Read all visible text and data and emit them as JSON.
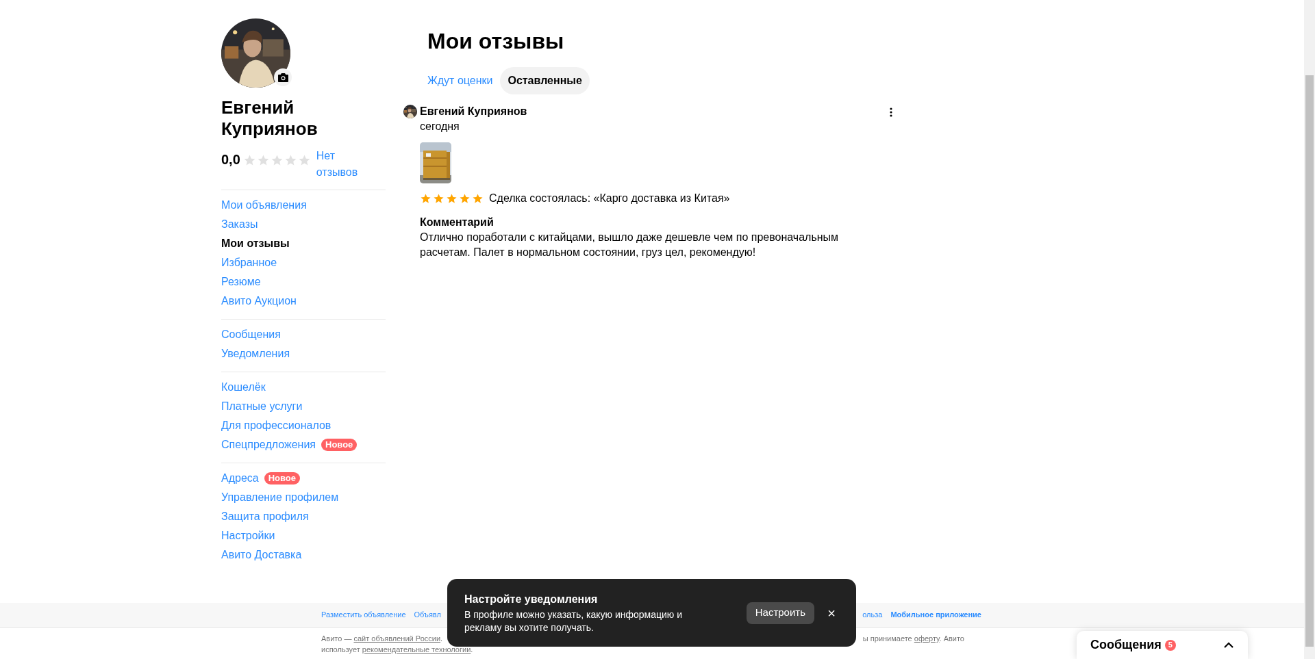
{
  "profile": {
    "name": "Евгений Куприянов",
    "rating": "0,0",
    "stars": 0,
    "reviews_link": "Нет отзывов"
  },
  "sidebar": {
    "groups": [
      {
        "items": [
          {
            "label": "Мои объявления",
            "selected": false
          },
          {
            "label": "Заказы",
            "selected": false
          },
          {
            "label": "Мои отзывы",
            "selected": true
          },
          {
            "label": "Избранное",
            "selected": false
          },
          {
            "label": "Резюме",
            "selected": false
          },
          {
            "label": "Авито Аукцион",
            "selected": false
          }
        ]
      },
      {
        "items": [
          {
            "label": "Сообщения",
            "selected": false
          },
          {
            "label": "Уведомления",
            "selected": false
          }
        ]
      },
      {
        "items": [
          {
            "label": "Кошелёк",
            "selected": false
          },
          {
            "label": "Платные услуги",
            "selected": false
          },
          {
            "label": "Для профессионалов",
            "selected": false
          },
          {
            "label": "Спецпредложения",
            "selected": false,
            "badge": "Новое"
          }
        ]
      },
      {
        "items": [
          {
            "label": "Адреса",
            "selected": false,
            "badge": "Новое"
          },
          {
            "label": "Управление профилем",
            "selected": false
          },
          {
            "label": "Защита профиля",
            "selected": false
          },
          {
            "label": "Настройки",
            "selected": false
          },
          {
            "label": "Авито Доставка",
            "selected": false
          }
        ]
      }
    ]
  },
  "page_title": "Мои отзывы",
  "tabs": [
    {
      "label": "Ждут оценки",
      "selected": false
    },
    {
      "label": "Оставленные",
      "selected": true
    }
  ],
  "reviews": [
    {
      "author": "Евгений Куприянов",
      "date": "сегодня",
      "stars": 5,
      "deal": "Сделка состоялась: «Карго доставка из Китая»",
      "comment_title": "Комментарий",
      "comment": "Отлично поработали с китайцами, вышло даже дешевле чем по превоначальным расчетам. Палет в нормальном состоянии, груз цел, рекомендую!"
    }
  ],
  "footer": {
    "links_left": [
      "Разместить объявление",
      "Объявл"
    ],
    "links_right": [
      "ользa",
      "Мобильное приложение"
    ],
    "text_left": {
      "before": "Авито — ",
      "link": "сайт объявлений России",
      "after": "."
    },
    "text_right": {
      "before": "ы принимаете ",
      "link": "оферту",
      "after": ". Авито"
    },
    "text_line2": {
      "before": "использует ",
      "link": "рекомендательные технологии",
      "after": "."
    }
  },
  "toast": {
    "title": "Настройте уведомления",
    "text": "В профиле можно указать, какую информацию и рекламу вы хотите получать.",
    "button": "Настроить",
    "close": "×"
  },
  "messages_widget": {
    "label": "Сообщения",
    "count": "5",
    "expanded": false
  }
}
